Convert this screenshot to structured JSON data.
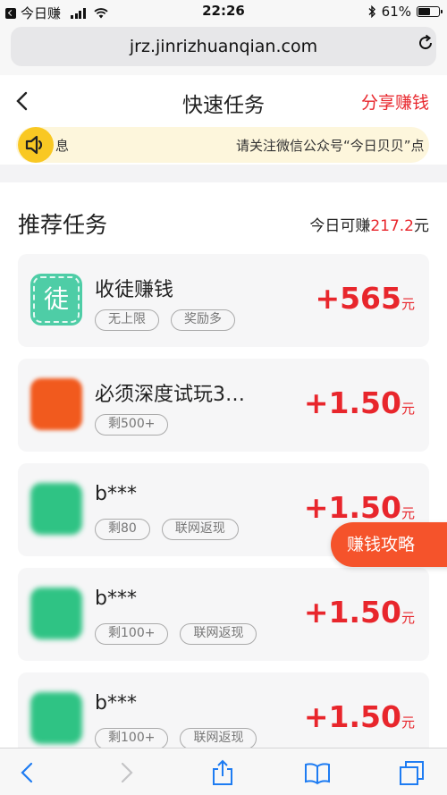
{
  "status_bar": {
    "back_app": "今日赚",
    "time": "22:26",
    "battery": "61%",
    "battery_level": 0.61
  },
  "browser": {
    "url": "jrz.jinrizhuanqian.com"
  },
  "header": {
    "title": "快速任务",
    "share_label": "分享赚钱"
  },
  "notice": {
    "text_a": "息",
    "text_b": "请关注微信公众号“今日贝贝”点"
  },
  "section": {
    "title": "推荐任务",
    "earn_prefix": "今日可赚",
    "earn_amount": "217.2",
    "earn_unit": "元"
  },
  "tasks": [
    {
      "name": "收徒赚钱",
      "icon_char": "徒",
      "tags": [
        "无上限",
        "奖励多"
      ],
      "reward": "+565",
      "unit": "元"
    },
    {
      "name": "必须深度试玩3…",
      "tags": [
        "剩500+"
      ],
      "reward": "+1.50",
      "unit": "元"
    },
    {
      "name": "b***",
      "tags": [
        "剩80",
        "联网返现"
      ],
      "reward": "+1.50",
      "unit": "元"
    },
    {
      "name": "b***",
      "tags": [
        "剩100+",
        "联网返现"
      ],
      "reward": "+1.50",
      "unit": "元"
    },
    {
      "name": "b***",
      "tags": [
        "剩100+",
        "联网返现"
      ],
      "reward": "+1.50",
      "unit": "元"
    }
  ],
  "floating": {
    "guide_label": "赚钱攻略"
  },
  "colors": {
    "accent_red": "#e8262c",
    "guide_orange": "#f5532b",
    "notice_bg": "#fdf6dc",
    "speaker_yellow": "#f9c823",
    "ios_blue": "#1e7cf2"
  },
  "toolbar_icons": [
    "back-icon",
    "forward-icon",
    "share-icon",
    "bookmarks-icon",
    "tabs-icon"
  ]
}
